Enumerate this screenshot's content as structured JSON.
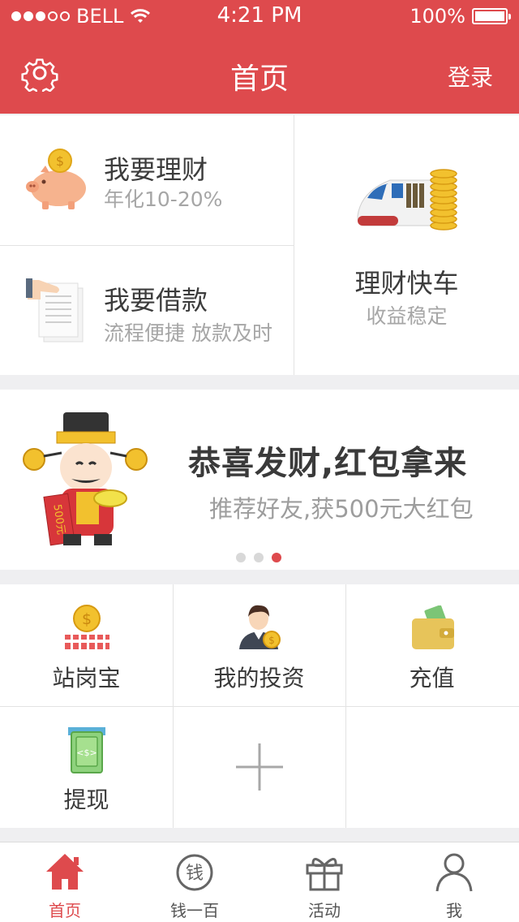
{
  "status_bar": {
    "carrier": "BELL",
    "time": "4:21 PM",
    "battery": "100%",
    "battery_level": 1.0,
    "signal_dots_filled": 3,
    "signal_dots_total": 5
  },
  "navbar": {
    "title": "首页",
    "login_label": "登录",
    "settings_icon": "gear-icon"
  },
  "finance_cards": {
    "invest": {
      "title": "我要理财",
      "subtitle": "年化10-20%",
      "icon": "piggy-bank-icon"
    },
    "loan": {
      "title": "我要借款",
      "subtitle": "流程便捷 放款及时",
      "icon": "loan-document-icon"
    },
    "express": {
      "title": "理财快车",
      "subtitle": "收益稳定",
      "icon": "bullet-train-coins-icon"
    }
  },
  "banner": {
    "title": "恭喜发财,红包拿来",
    "subtitle": "推荐好友,获500元大红包",
    "figure_sign": "500元",
    "page_count": 3,
    "active_page": 3
  },
  "services": [
    {
      "label": "站岗宝",
      "icon": "coin-fence-icon"
    },
    {
      "label": "我的投资",
      "icon": "investor-icon"
    },
    {
      "label": "充值",
      "icon": "wallet-icon"
    },
    {
      "label": "提现",
      "icon": "withdraw-cash-icon"
    },
    {
      "label": "",
      "icon": "add-icon"
    }
  ],
  "tabbar": [
    {
      "label": "首页",
      "icon": "home-icon",
      "active": true
    },
    {
      "label": "钱一百",
      "icon": "money-icon",
      "glyph": "钱",
      "active": false
    },
    {
      "label": "活动",
      "icon": "gift-icon",
      "active": false
    },
    {
      "label": "我",
      "icon": "user-icon",
      "active": false
    }
  ],
  "colors": {
    "brand": "#de4a4d",
    "gold": "#f2c12e",
    "background": "#efeff1"
  }
}
